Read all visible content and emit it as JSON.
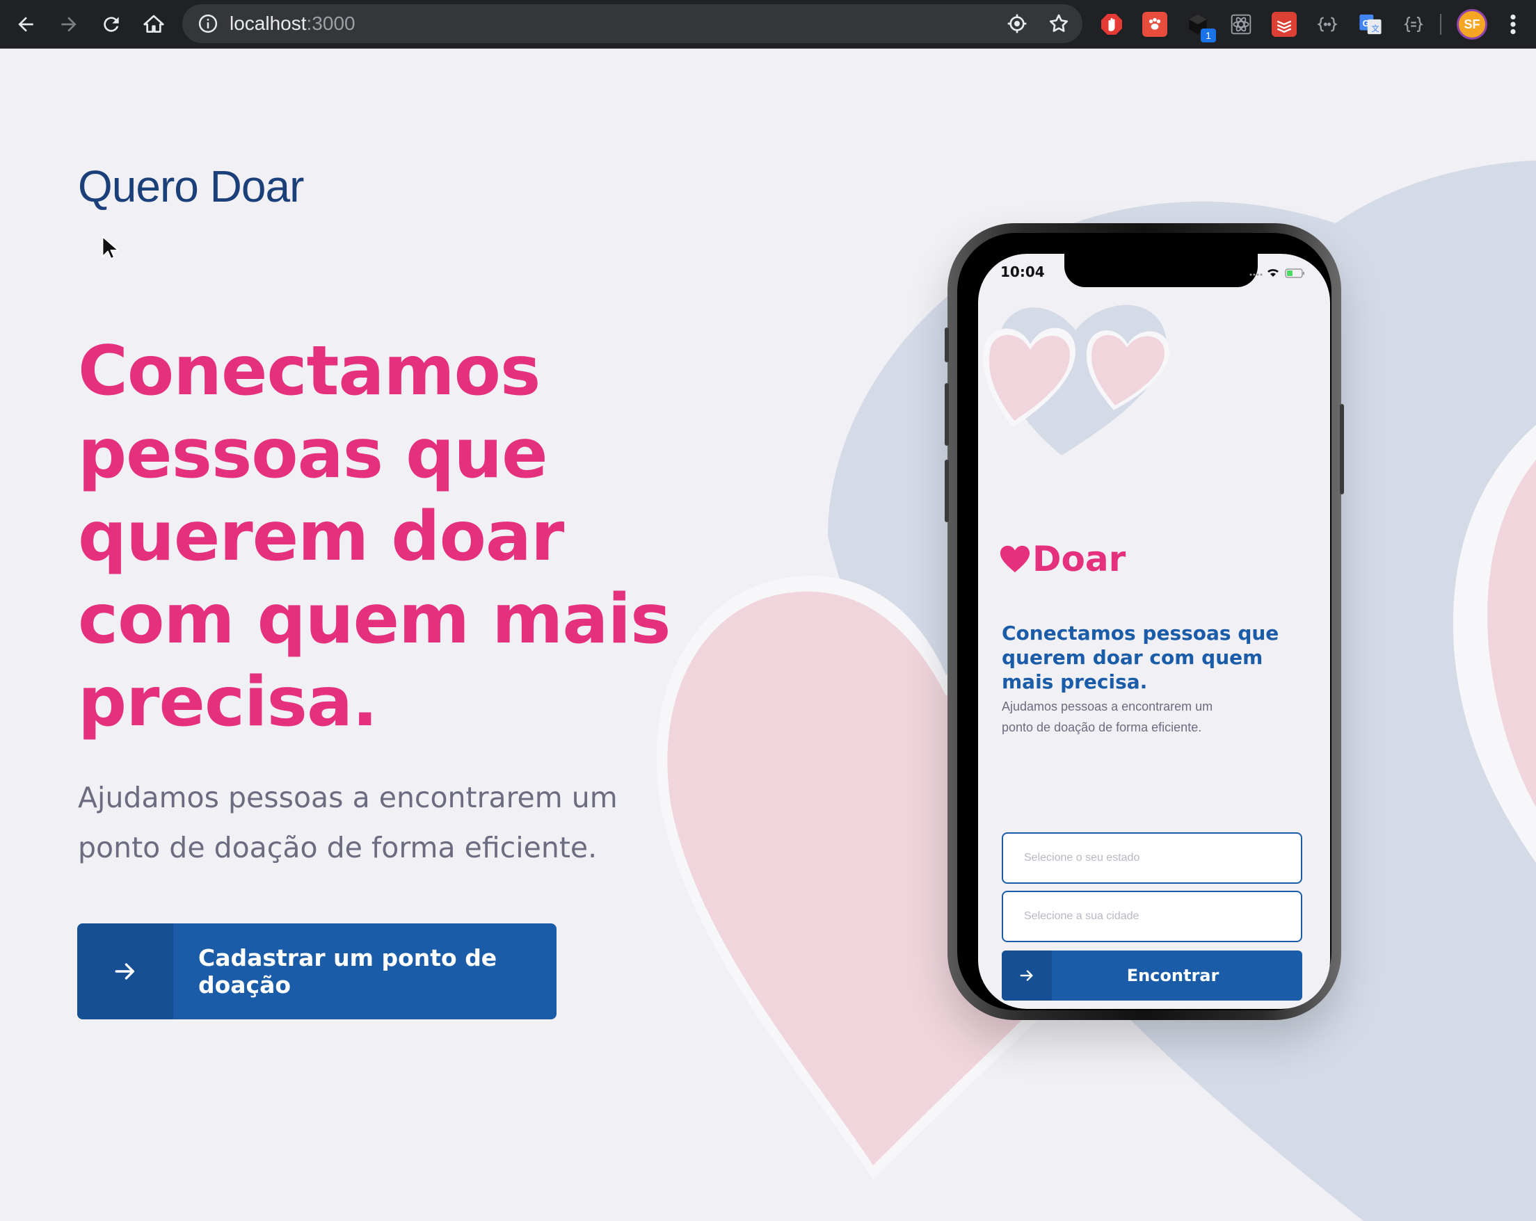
{
  "browser": {
    "url_host": "localhost",
    "url_port": ":3000",
    "extensions": [
      {
        "name": "adblock-icon",
        "color": "#e53935"
      },
      {
        "name": "paw-icon",
        "color": "#e74c3c"
      },
      {
        "name": "cube-icon",
        "color": "#202124",
        "badge": "1"
      },
      {
        "name": "react-devtools-icon",
        "color": "#9aa0a6"
      },
      {
        "name": "todoist-icon",
        "color": "#db4035"
      },
      {
        "name": "brackets-icon",
        "color": "#9aa0a6"
      },
      {
        "name": "google-translate-icon",
        "color": "#4285f4"
      },
      {
        "name": "json-viewer-icon",
        "color": "#9aa0a6"
      }
    ],
    "profile_initials": "SF"
  },
  "page": {
    "logo": "Quero Doar",
    "headline": "Conectamos pessoas que querem doar com quem mais precisa.",
    "subtext": "Ajudamos pessoas a encontrarem um ponto de doação de forma eficiente.",
    "cta_label": "Cadastrar um ponto de doação"
  },
  "phone": {
    "time": "10:04",
    "app_logo": "Doar",
    "title": "Conectamos pessoas que querem doar com quem mais precisa.",
    "description": "Ajudamos pessoas a encontrarem um ponto de doação de forma eficiente.",
    "state_placeholder": "Selecione o seu estado",
    "city_placeholder": "Selecione a sua cidade",
    "button_label": "Encontrar"
  },
  "colors": {
    "pink": "#e4307d",
    "blue": "#1a5ca8",
    "blue_dark": "#164f93",
    "navy": "#1b3f78",
    "background": "#f0f0f5",
    "muted_text": "#6c6c80",
    "heart_pink": "#f0d5dc",
    "heart_blue": "#d4dbe7"
  }
}
